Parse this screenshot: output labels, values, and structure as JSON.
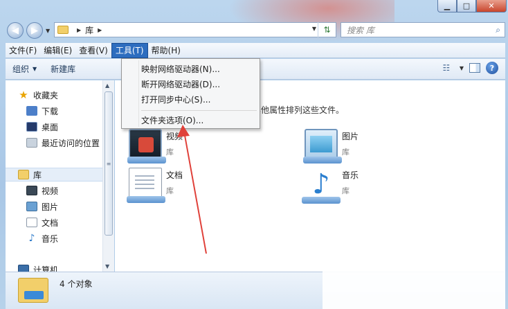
{
  "address": {
    "path": [
      "库"
    ],
    "search_placeholder": "搜索 库"
  },
  "menubar": {
    "items": [
      "文件(F)",
      "编辑(E)",
      "查看(V)",
      "工具(T)",
      "帮助(H)"
    ],
    "active_index": 3
  },
  "toolbar": {
    "organize": "组织",
    "new_library": "新建库"
  },
  "tools_menu": {
    "items": [
      "映射网络驱动器(N)...",
      "断开网络驱动器(D)...",
      "打开同步中心(S)...",
      "文件夹选项(O)..."
    ]
  },
  "sidebar": {
    "favorites": {
      "label": "收藏夹",
      "items": [
        "下载",
        "桌面",
        "最近访问的位置"
      ]
    },
    "libraries": {
      "label": "库",
      "items": [
        "视频",
        "图片",
        "文档",
        "音乐"
      ]
    },
    "computer": "计算机"
  },
  "main": {
    "description": "期和其他属性排列这些文件。",
    "libraries": [
      {
        "name": "视频",
        "sub": "库",
        "icon": "video-library-icon"
      },
      {
        "name": "图片",
        "sub": "库",
        "icon": "pictures-library-icon"
      },
      {
        "name": "文档",
        "sub": "库",
        "icon": "documents-library-icon"
      },
      {
        "name": "音乐",
        "sub": "库",
        "icon": "music-library-icon"
      }
    ]
  },
  "status": {
    "count_text": "4 个对象"
  },
  "colors": {
    "menu_active": "#2d6dbf",
    "annotation_arrow": "#e0413a"
  }
}
